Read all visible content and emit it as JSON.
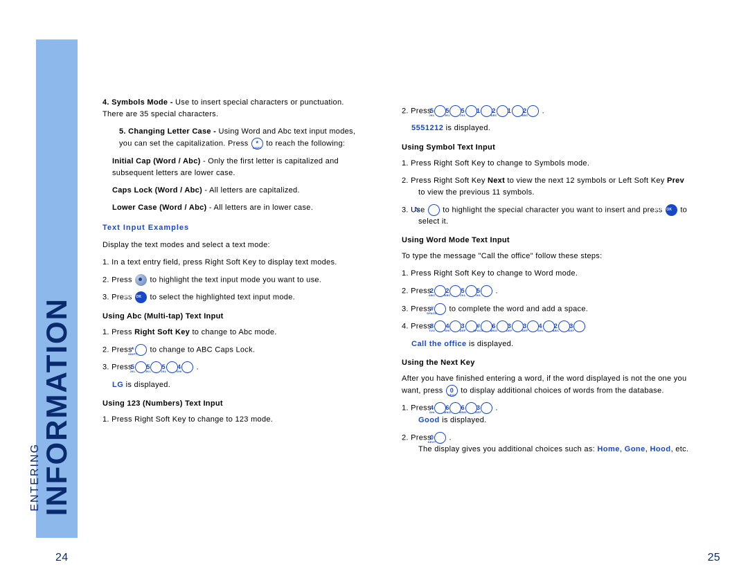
{
  "sidebar": {
    "big": "INFORMATION",
    "small": "ENTERING"
  },
  "pages": {
    "left": "24",
    "right": "25"
  },
  "left": {
    "p1a": "4. Symbols Mode - ",
    "p1b": "Use to insert special characters or punctuation. There are 35 special characters.",
    "p2a": "5. Changing Letter Case - ",
    "p2b": "Using Word and Abc text input modes, you can set the capitalization. Press ",
    "p2c": " to reach the following:",
    "p3a": "Initial Cap (Word / Abc)",
    "p3b": " - Only the first letter is capitalized and subsequent letters are lower case.",
    "p4a": "Caps Lock (Word / Abc)",
    "p4b": " - All letters are capitalized.",
    "p5a": "Lower Case (Word / Abc)",
    "p5b": " - All letters are in lower case.",
    "h1": "Text Input Examples",
    "p6": "Display the text modes and select a text mode:",
    "p7": "1. In a text entry field, press Right Soft Key to display text modes.",
    "p8a": "2. Press ",
    "p8b": " to highlight the text input mode you want to use.",
    "p9a": "3. Press ",
    "p9b": " to select the highlighted text input mode.",
    "h2": "Using Abc (Multi-tap) Text Input",
    "p10a": "1. Press ",
    "p10b": "Right Soft Key",
    "p10c": " to change to Abc mode.",
    "p11a": "2. Press ",
    "p11b": " to change to ABC Caps Lock.",
    "p12": "3. Press ",
    "p13a": "LG",
    "p13b": " is displayed.",
    "h3": "Using 123 (Numbers) Text Input",
    "p14": "1. Press Right Soft Key to change to 123 mode."
  },
  "right": {
    "p1": "2. Press ",
    "p1end": " .",
    "p2a": "5551212",
    "p2b": " is displayed.",
    "h1": "Using Symbol Text Input",
    "p3": "1. Press Right Soft Key to change to Symbols mode.",
    "p4a": "2. Press Right Soft Key ",
    "p4b": "Next",
    "p4c": " to view the next 12 symbols or Left Soft Key ",
    "p4d": "Prev",
    "p4e": " to view the previous 11 symbols.",
    "p5a": "3. Use ",
    "p5b": " to highlight the special character you want to insert and press ",
    "p5c": " to select it.",
    "h2": "Using Word Mode Text Input",
    "p6": "To type the message \"Call the office\" follow these steps:",
    "p7": "1. Press Right Soft Key to change to Word mode.",
    "p8": "2. Press ",
    "p9a": "3. Press ",
    "p9b": " to complete the word and add a space.",
    "p10": "4. Press ",
    "p11a": "Call the office",
    "p11b": " is displayed.",
    "h3": "Using the Next Key",
    "p12a": "After you have finished entering a word, if the word displayed is not the one you want, press ",
    "p12b": " to display additional choices of words from the database.",
    "p13": "1. Press ",
    "p14a": "Good",
    "p14b": " is displayed.",
    "p15": "2. Press ",
    "p16a": "The display gives you additional choices such as: ",
    "p16b": "Home",
    "p16c": ", ",
    "p16d": "Gone",
    "p16e": ", ",
    "p16f": "Hood",
    "p16g": ", etc."
  },
  "keys": {
    "k0": "0",
    "k1": "1",
    "k2": "2",
    "k3": "3",
    "k4": "4",
    "k5": "5",
    "k6": "6",
    "k8": "8",
    "star": "*",
    "hash": "#",
    "sub_abc": "ABC",
    "sub_def": "DEF",
    "sub_ghi": "GHI",
    "sub_jkl": "JKL",
    "sub_mno": "MNO",
    "sub_tuv": "TUV",
    "sub_shift": "SHIFT",
    "sub_space": "SPACE",
    "sub_next": "NEXT",
    "menu": "MENU OK"
  }
}
